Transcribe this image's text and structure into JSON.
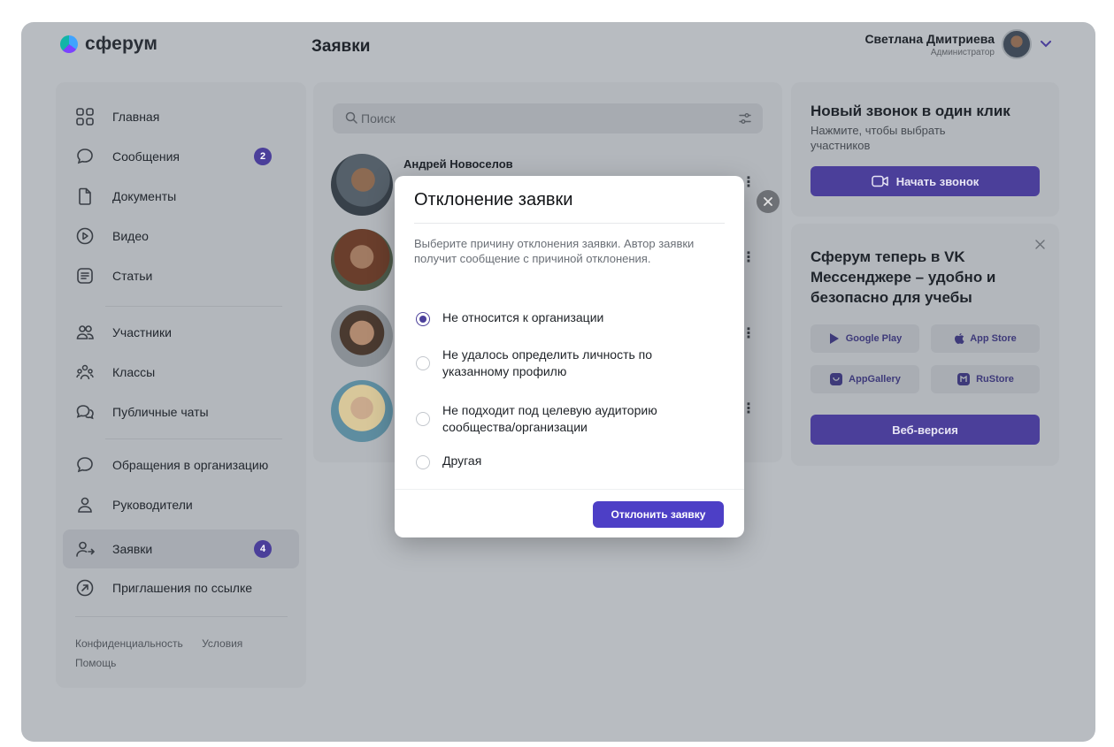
{
  "app": {
    "logo_text": "сферум",
    "page_title": "Заявки"
  },
  "user": {
    "name": "Светлана Дмитриева",
    "role": "Администратор"
  },
  "sidebar": {
    "items": [
      {
        "label": "Главная",
        "icon": "grid-icon"
      },
      {
        "label": "Сообщения",
        "icon": "chat-bubble-icon",
        "badge": "2"
      },
      {
        "label": "Документы",
        "icon": "document-icon"
      },
      {
        "label": "Видео",
        "icon": "play-circle-icon"
      },
      {
        "label": "Статьи",
        "icon": "article-icon"
      },
      {
        "label": "Участники",
        "icon": "people-icon"
      },
      {
        "label": "Классы",
        "icon": "class-group-icon"
      },
      {
        "label": "Публичные чаты",
        "icon": "public-chat-icon"
      },
      {
        "label": "Обращения в организацию",
        "icon": "chat-bubble-icon"
      },
      {
        "label": "Руководители",
        "icon": "person-icon"
      },
      {
        "label": "Заявки",
        "icon": "person-arrow-icon",
        "badge": "4",
        "active": true
      },
      {
        "label": "Приглашения по ссылке",
        "icon": "link-arrow-icon"
      }
    ],
    "footer": {
      "privacy": "Конфиденциальность",
      "terms": "Условия",
      "help": "Помощь"
    }
  },
  "search": {
    "placeholder": "Поиск"
  },
  "requests": [
    {
      "name": "Андрей Новоселов"
    }
  ],
  "call_card": {
    "title": "Новый звонок в один клик",
    "subtitle": "Нажмите, чтобы выбрать участников",
    "button": "Начать звонок"
  },
  "promo_card": {
    "title": "Сферум теперь в VK Мессенджере – удобно и безопасно для учебы",
    "stores": {
      "google": "Google Play",
      "apple": "App Store",
      "gallery": "AppGallery",
      "rustore": "RuStore"
    },
    "web_button": "Веб-версия"
  },
  "modal": {
    "title": "Отклонение заявки",
    "description": "Выберите причину отклонения заявки. Автор заявки получит сообщение с причиной отклонения.",
    "options": [
      {
        "label": "Не относится к организации",
        "checked": true
      },
      {
        "label": "Не удалось определить личность по указанному профилю",
        "checked": false
      },
      {
        "label": "Не подходит под целевую аудиторию сообщества/организации",
        "checked": false
      },
      {
        "label": "Другая",
        "checked": false
      }
    ],
    "confirm_button": "Отклонить заявку"
  },
  "colors": {
    "accent": "#4b3f9a",
    "modal_button": "#4d3fc6",
    "overlay": "#b8bcc1"
  }
}
